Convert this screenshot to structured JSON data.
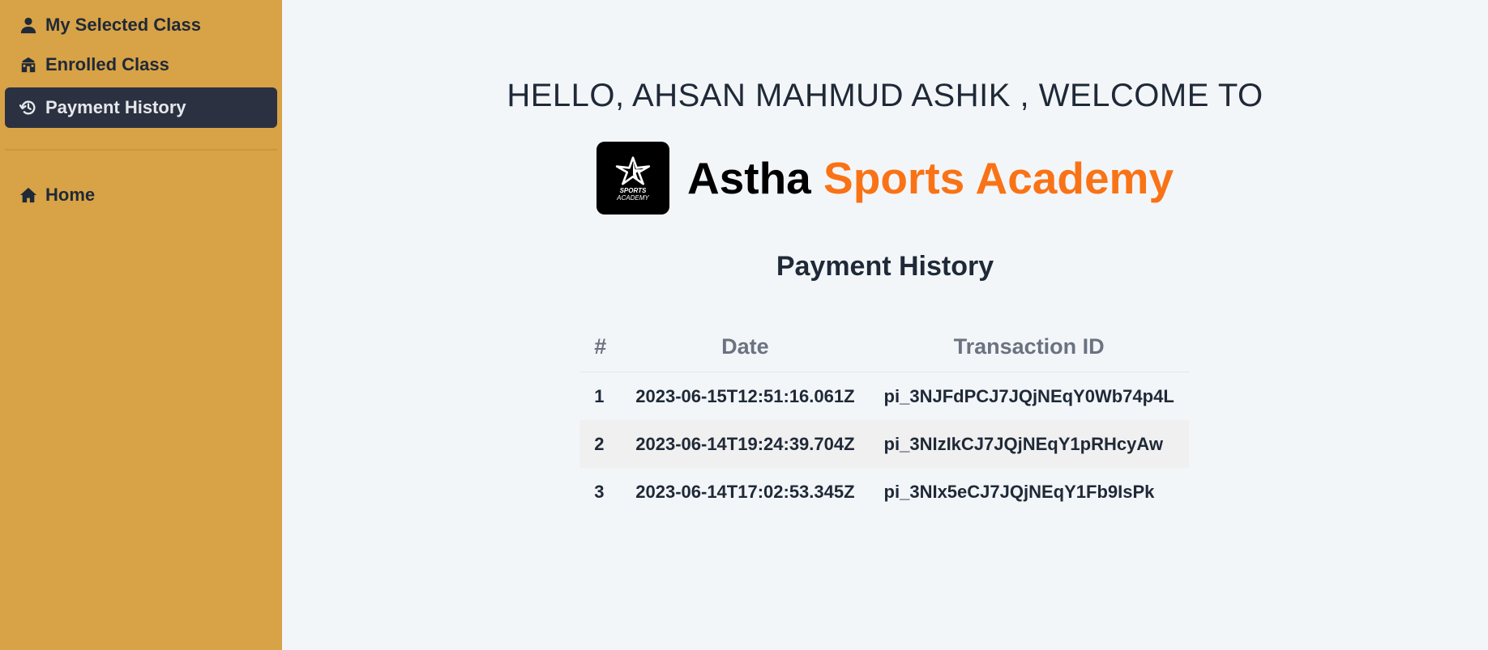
{
  "sidebar": {
    "items": [
      {
        "label": "My Selected Class",
        "icon": "user-icon"
      },
      {
        "label": "Enrolled Class",
        "icon": "school-icon"
      },
      {
        "label": "Payment History",
        "icon": "history-icon",
        "active": true
      }
    ],
    "home": {
      "label": "Home",
      "icon": "home-icon"
    }
  },
  "main": {
    "welcome": "HELLO, AHSAN MAHMUD ASHIK , WELCOME TO",
    "brand": {
      "first": "Astha",
      "second": "Sports Academy",
      "logo_text_1": "SPORTS",
      "logo_text_2": "ACADEMY"
    },
    "section_title": "Payment History",
    "table": {
      "headers": [
        "#",
        "Date",
        "Transaction ID"
      ],
      "rows": [
        {
          "index": "1",
          "date": "2023-06-15T12:51:16.061Z",
          "transaction_id": "pi_3NJFdPCJ7JQjNEqY0Wb74p4L"
        },
        {
          "index": "2",
          "date": "2023-06-14T19:24:39.704Z",
          "transaction_id": "pi_3NIzIkCJ7JQjNEqY1pRHcyAw"
        },
        {
          "index": "3",
          "date": "2023-06-14T17:02:53.345Z",
          "transaction_id": "pi_3NIx5eCJ7JQjNEqY1Fb9IsPk"
        }
      ]
    }
  },
  "colors": {
    "sidebar_bg": "#d8a246",
    "active_item_bg": "#2b3141",
    "accent_orange": "#f97316",
    "page_bg": "#f3f6f9"
  }
}
